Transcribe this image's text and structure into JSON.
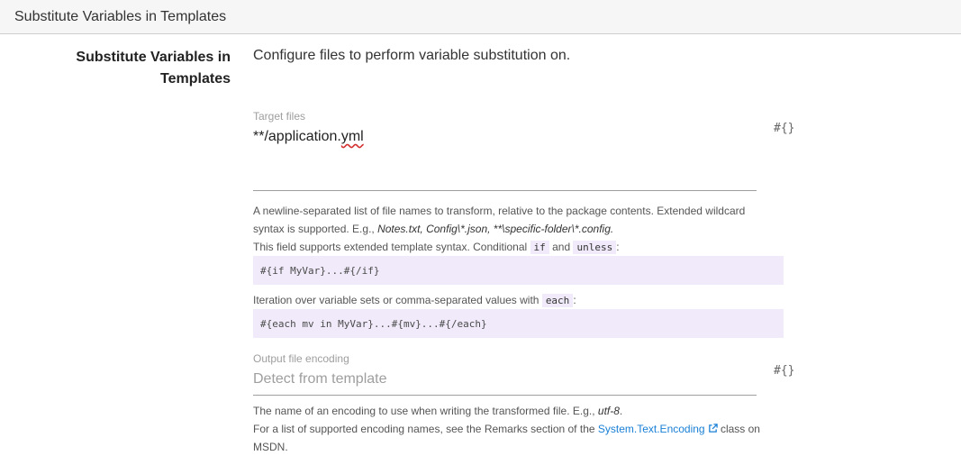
{
  "header": {
    "title": "Substitute Variables in Templates"
  },
  "section": {
    "title_line1": "Substitute Variables in",
    "title_line2": "Templates",
    "description": "Configure files to perform variable substitution on."
  },
  "target_files": {
    "label": "Target files",
    "value_prefix": "**/application.",
    "value_suffix": "yml",
    "variable_button": "#{}",
    "help_line1": "A newline-separated list of file names to transform, relative to the package contents. Extended wildcard",
    "help_line2_prefix": "syntax is supported. E.g., ",
    "help_example": "Notes.txt, Config\\*.json, **\\specific-folder\\*.config.",
    "help_line3_prefix": "This field supports extended template syntax. Conditional ",
    "kw_if": "if",
    "and_text": " and ",
    "kw_unless": "unless",
    "colon": ":",
    "code_if": "#{if MyVar}...#{/if}",
    "iteration_prefix": "Iteration over variable sets or comma-separated values with ",
    "kw_each": "each",
    "code_each": "#{each mv in MyVar}...#{mv}...#{/each}"
  },
  "output_encoding": {
    "label": "Output file encoding",
    "placeholder": "Detect from template",
    "variable_button": "#{}",
    "help_line1_prefix": "The name of an encoding to use when writing the transformed file. E.g., ",
    "help_example": "utf-8",
    "help_line1_suffix": ".",
    "help_line2_prefix": "For a list of supported encoding names, see the Remarks section of the ",
    "link_text": "System.Text.Encoding",
    "help_line2_suffix": " class on",
    "help_line3": "MSDN."
  },
  "colors": {
    "link": "#1a80d6",
    "code_bg": "#f1eafa",
    "header_bg": "#f6f6f6"
  },
  "icons": {
    "external_link": "external-link-icon"
  }
}
